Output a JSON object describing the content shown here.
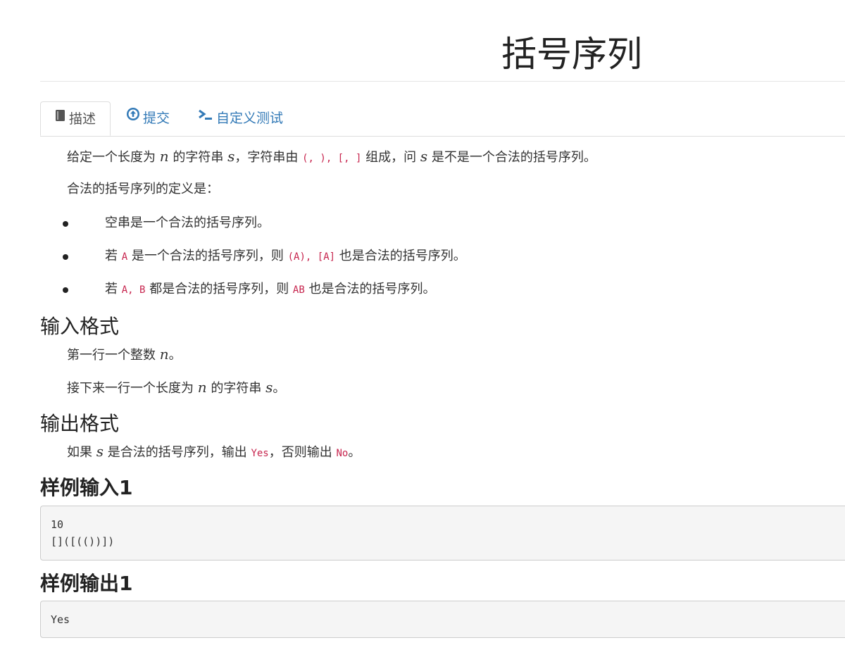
{
  "page": {
    "title": "括号序列"
  },
  "tabs": [
    {
      "label": "描述",
      "icon": "book-icon",
      "active": true
    },
    {
      "label": "提交",
      "icon": "upload-circle-icon",
      "active": false
    },
    {
      "label": "自定义测试",
      "icon": "terminal-icon",
      "active": false
    }
  ],
  "description": {
    "intro": {
      "t1": "给定一个长度为 ",
      "m1": "n",
      "t2": " 的字符串 ",
      "m2": "s",
      "t3": "，字符串由 ",
      "c1": "(",
      "sep1": ", ",
      "c2": ")",
      "sep2": ", ",
      "c3": "[",
      "sep3": ", ",
      "c4": "]",
      "t4": " 组成，问 ",
      "m3": "s",
      "t5": " 是不是一个合法的括号序列。"
    },
    "definition_heading": "合法的括号序列的定义是：",
    "rules": {
      "r1": "空串是一个合法的括号序列。",
      "r2_t1": "若 ",
      "r2_c1": "A",
      "r2_t2": " 是一个合法的括号序列，则 ",
      "r2_c2": "(A)",
      "r2_sep": ", ",
      "r2_c3": "[A]",
      "r2_t3": " 也是合法的括号序列。",
      "r3_t1": "若 ",
      "r3_c1": "A",
      "r3_sep": ", ",
      "r3_c2": "B",
      "r3_t2": " 都是合法的括号序列，则 ",
      "r3_c3": "AB",
      "r3_t3": " 也是合法的括号序列。"
    }
  },
  "input_format": {
    "heading": "输入格式",
    "line1_t1": "第一行一个整数 ",
    "line1_m1": "n",
    "line1_t2": "。",
    "line2_t1": "接下来一行一个长度为 ",
    "line2_m1": "n",
    "line2_t2": " 的字符串 ",
    "line2_m2": "s",
    "line2_t3": "。"
  },
  "output_format": {
    "heading": "输出格式",
    "t1": "如果 ",
    "m1": "s",
    "t2": " 是合法的括号序列，输出 ",
    "c1": "Yes",
    "t3": "，否则输出 ",
    "c2": "No",
    "t4": "。"
  },
  "sample_input": {
    "heading": "样例输入1",
    "content": "10\n[]([(())])"
  },
  "sample_output": {
    "heading": "样例输出1",
    "content": "Yes"
  }
}
